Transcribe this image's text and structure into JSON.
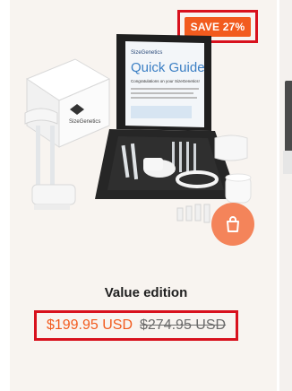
{
  "badge": {
    "label": "SAVE 27%"
  },
  "product": {
    "title": "Value edition",
    "sale_price": "$199.95 USD",
    "original_price": "$274.95 USD"
  },
  "images": {
    "box_brand": "SizeGenetics",
    "guide_title": "Quick Guide",
    "guide_brand": "SizeGenetics",
    "guide_heading": "Congratulations on your SizeGenetics!"
  },
  "colors": {
    "accent": "#f25b1e",
    "highlight_border": "#d8111d",
    "card_bg": "#f8f4f0"
  },
  "icons": {
    "add_to_cart": "shopping-bag-icon"
  }
}
